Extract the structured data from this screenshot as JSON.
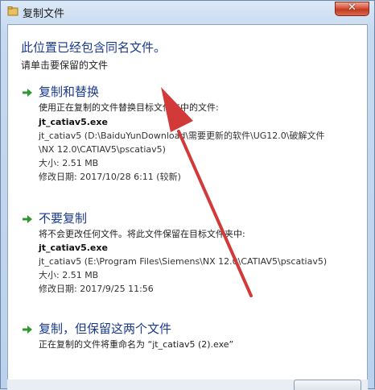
{
  "window": {
    "title": "复制文件"
  },
  "header": {
    "heading": "此位置已经包含同名文件。",
    "subheading": "请单击要保留的文件"
  },
  "options": [
    {
      "title": "复制和替换",
      "description": "使用正在复制的文件替换目标文件夹中的文件:",
      "file_name": "jt_catiav5.exe",
      "path_line1": "jt_catiav5 (D:\\BaiduYunDownload\\需要更新的软件\\UG12.0\\破解文件",
      "path_line2": "\\NX 12.0\\CATIAV5\\pscatiav5)",
      "size": "大小: 2.51 MB",
      "modified": "修改日期: 2017/10/28 6:11 (较新)"
    },
    {
      "title": "不要复制",
      "description": "将不会更改任何文件。将此文件保留在目标文件夹中:",
      "file_name": "jt_catiav5.exe",
      "path_line1": "jt_catiav5 (E:\\Program Files\\Siemens\\NX 12.0\\CATIAV5\\pscatiav5)",
      "size": "大小: 2.51 MB",
      "modified": "修改日期: 2017/9/25 11:56"
    },
    {
      "title": "复制，但保留这两个文件",
      "description": "正在复制的文件将重命名为 “jt_catiav5 (2).exe”"
    }
  ],
  "colors": {
    "accent": "#1a3a8c",
    "arrow_green": "#2e9a2e",
    "annotation_red": "#d23a3a"
  }
}
